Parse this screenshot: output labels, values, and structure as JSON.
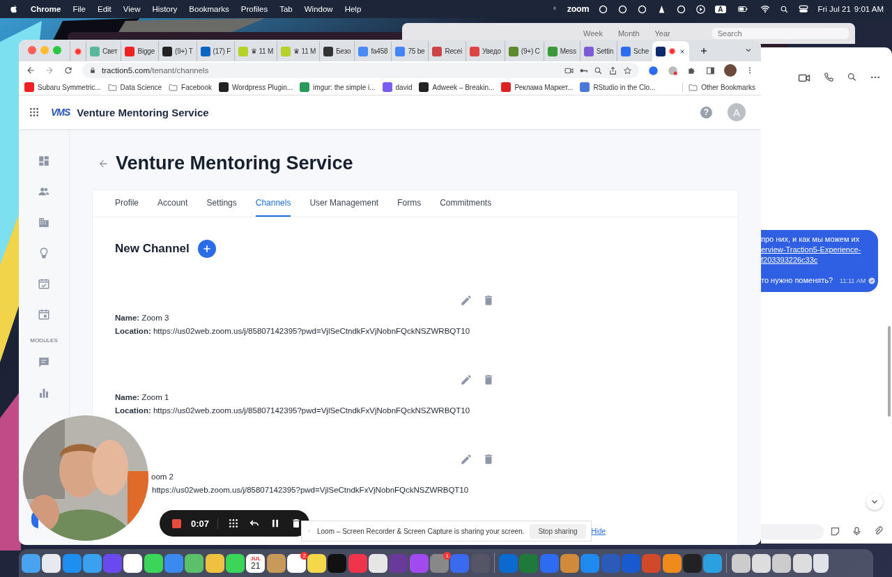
{
  "menubar": {
    "app": "Chrome",
    "menus": [
      "File",
      "Edit",
      "View",
      "History",
      "Bookmarks",
      "Profiles",
      "Tab",
      "Window",
      "Help"
    ],
    "zoom": "zoom",
    "input_source": "A",
    "date": "Fri Jul 21",
    "time": "9:01 AM"
  },
  "background_window": {
    "views": [
      "Week",
      "Month",
      "Year"
    ],
    "search_placeholder": "Search"
  },
  "browser": {
    "tabs": [
      {
        "selected": false
      },
      {
        "title": "Свет",
        "selected": false
      },
      {
        "title": "Bigge",
        "selected": false
      },
      {
        "title": "(9+) T",
        "selected": false
      },
      {
        "title": "(17) F",
        "selected": false
      },
      {
        "title": "♛ 11 M",
        "selected": false
      },
      {
        "title": "♛ 11 M",
        "selected": false
      },
      {
        "title": "Безо",
        "selected": false
      },
      {
        "title": "fa458",
        "selected": false
      },
      {
        "title": "75 be",
        "selected": false
      },
      {
        "title": "Recei",
        "selected": false
      },
      {
        "title": "Уведо",
        "selected": false
      },
      {
        "title": "(9+) C",
        "selected": false
      },
      {
        "title": "Mess",
        "selected": false
      },
      {
        "title": "Settin",
        "selected": false
      },
      {
        "title": "Sche",
        "selected": false
      },
      {
        "selected": true
      }
    ],
    "url_host": "traction5.com",
    "url_path": "/tenant/channels",
    "bookmarks": [
      "Subaru Symmetric...",
      "Data Science",
      "Facebook",
      "Wordpress Plugin...",
      "imgur: the simple i...",
      "david",
      "Adweek – Breakin...",
      "Реклама Маркет...",
      "RStudio in the Clo..."
    ],
    "other_bookmarks": "Other Bookmarks"
  },
  "app": {
    "logo": "VMS",
    "name": "Venture Mentoring Service",
    "help": "?",
    "avatar": "A",
    "sidebar_section": "MODULES",
    "page_title": "Venture Mentoring Service",
    "tabs": [
      {
        "label": "Profile",
        "selected": false
      },
      {
        "label": "Account",
        "selected": false
      },
      {
        "label": "Settings",
        "selected": false
      },
      {
        "label": "Channels",
        "selected": true
      },
      {
        "label": "User Management",
        "selected": false
      },
      {
        "label": "Forms",
        "selected": false
      },
      {
        "label": "Commitments",
        "selected": false
      }
    ],
    "new_channel": "New Channel",
    "channels": [
      {
        "name_label": "Name:",
        "name": "Zoom 3",
        "location_label": "Location:",
        "location": "https://us02web.zoom.us/j/85807142395?pwd=VjlSeCtndkFxVjNobnFQckNSZWRBQT10"
      },
      {
        "name_label": "Name:",
        "name": "Zoom 1",
        "location_label": "Location:",
        "location": "https://us02web.zoom.us/j/85807142395?pwd=VjlSeCtndkFxVjNobnFQckNSZWRBQT10"
      },
      {
        "name": "oom 2",
        "location": "https://us02web.zoom.us/j/85807142395?pwd=VjlSeCtndkFxVjNobnFQckNSZWRBQT10"
      }
    ]
  },
  "chat": {
    "lines": [
      {
        "kind": "text",
        "text": "про них, и как мы можем их"
      },
      {
        "kind": "link",
        "text": "erview-Traction5-Experience-"
      },
      {
        "kind": "link",
        "text": "f203393226c33c"
      },
      {
        "kind": "gap"
      },
      {
        "kind": "text",
        "text": "то нужно поменять?"
      }
    ],
    "time": "11:11 AM"
  },
  "loom": {
    "timer": "0:07",
    "notice": "Loom – Screen Recorder & Screen Capture is sharing your screen.",
    "stop": "Stop sharing",
    "hide": "Hide"
  },
  "dock": {
    "items": [
      {
        "kind": "app"
      },
      {
        "kind": "app"
      },
      {
        "kind": "app"
      },
      {
        "kind": "app"
      },
      {
        "kind": "app"
      },
      {
        "kind": "app"
      },
      {
        "kind": "app"
      },
      {
        "kind": "app"
      },
      {
        "kind": "app"
      },
      {
        "kind": "app"
      },
      {
        "kind": "app"
      },
      {
        "kind": "calendar",
        "month": "JUL",
        "day": "21"
      },
      {
        "kind": "app"
      },
      {
        "kind": "app",
        "badge": "2"
      },
      {
        "kind": "app"
      },
      {
        "kind": "app"
      },
      {
        "kind": "app"
      },
      {
        "kind": "app"
      },
      {
        "kind": "app"
      },
      {
        "kind": "app"
      },
      {
        "kind": "app",
        "badge": "1"
      },
      {
        "kind": "app"
      },
      {
        "kind": "app"
      },
      {
        "kind": "separator"
      },
      {
        "kind": "app"
      },
      {
        "kind": "app"
      },
      {
        "kind": "app"
      },
      {
        "kind": "app"
      },
      {
        "kind": "app"
      },
      {
        "kind": "app"
      },
      {
        "kind": "app"
      },
      {
        "kind": "app"
      },
      {
        "kind": "app"
      },
      {
        "kind": "app"
      },
      {
        "kind": "app"
      },
      {
        "kind": "separator"
      },
      {
        "kind": "app"
      },
      {
        "kind": "app"
      },
      {
        "kind": "app"
      },
      {
        "kind": "app"
      },
      {
        "kind": "trash"
      }
    ]
  }
}
